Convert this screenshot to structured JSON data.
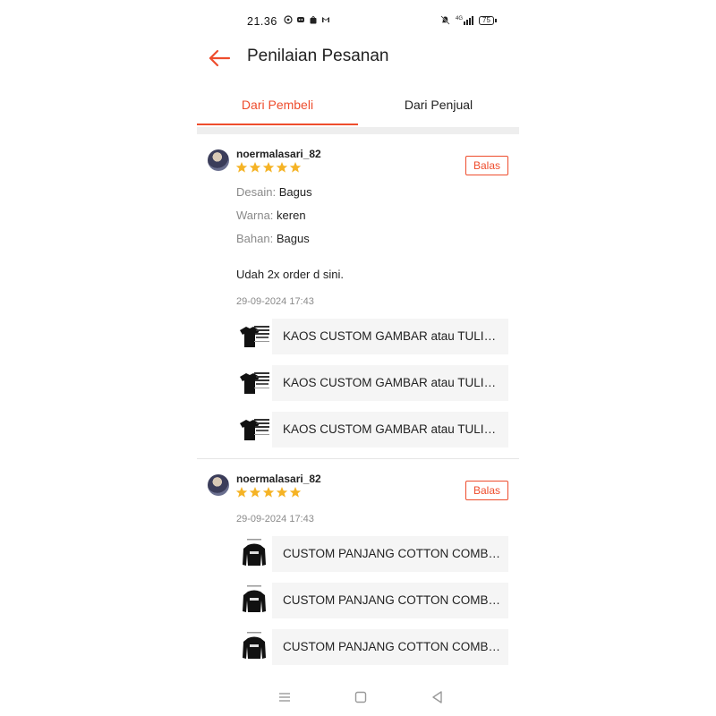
{
  "status_bar": {
    "time": "21.36",
    "notification_icons": [
      "whatsapp-icon",
      "discord-icon",
      "shopee-icon",
      "gmail-icon"
    ],
    "right_icons": [
      "mute-icon",
      "signal-icon"
    ],
    "network": "4G",
    "battery": "75"
  },
  "header": {
    "title": "Penilaian Pesanan"
  },
  "tabs": [
    {
      "label": "Dari Pembeli",
      "active": true
    },
    {
      "label": "Dari Penjual",
      "active": false
    }
  ],
  "reviews": [
    {
      "username": "noermalasari_82",
      "rating": 5,
      "reply_label": "Balas",
      "attributes": [
        {
          "key": "Desain:",
          "value": "Bagus"
        },
        {
          "key": "Warna:",
          "value": "keren"
        },
        {
          "key": "Bahan:",
          "value": "Bagus"
        }
      ],
      "comment": "Udah 2x order d sini.",
      "timestamp": "29-09-2024 17:43",
      "products": [
        "KAOS CUSTOM GAMBAR atau TULISAN",
        "KAOS CUSTOM GAMBAR atau TULISAN",
        "KAOS CUSTOM GAMBAR atau TULISAN"
      ]
    },
    {
      "username": "noermalasari_82",
      "rating": 5,
      "reply_label": "Balas",
      "timestamp": "29-09-2024 17:43",
      "products": [
        "CUSTOM PANJANG COTTON COMBED",
        "CUSTOM PANJANG COTTON COMBED",
        "CUSTOM PANJANG COTTON COMBED"
      ]
    }
  ],
  "colors": {
    "accent": "#ee4d2d",
    "star": "#f5b325",
    "muted": "#8a8a8a"
  },
  "nav_bar": [
    "menu-icon",
    "home-icon",
    "back-triangle-icon"
  ]
}
